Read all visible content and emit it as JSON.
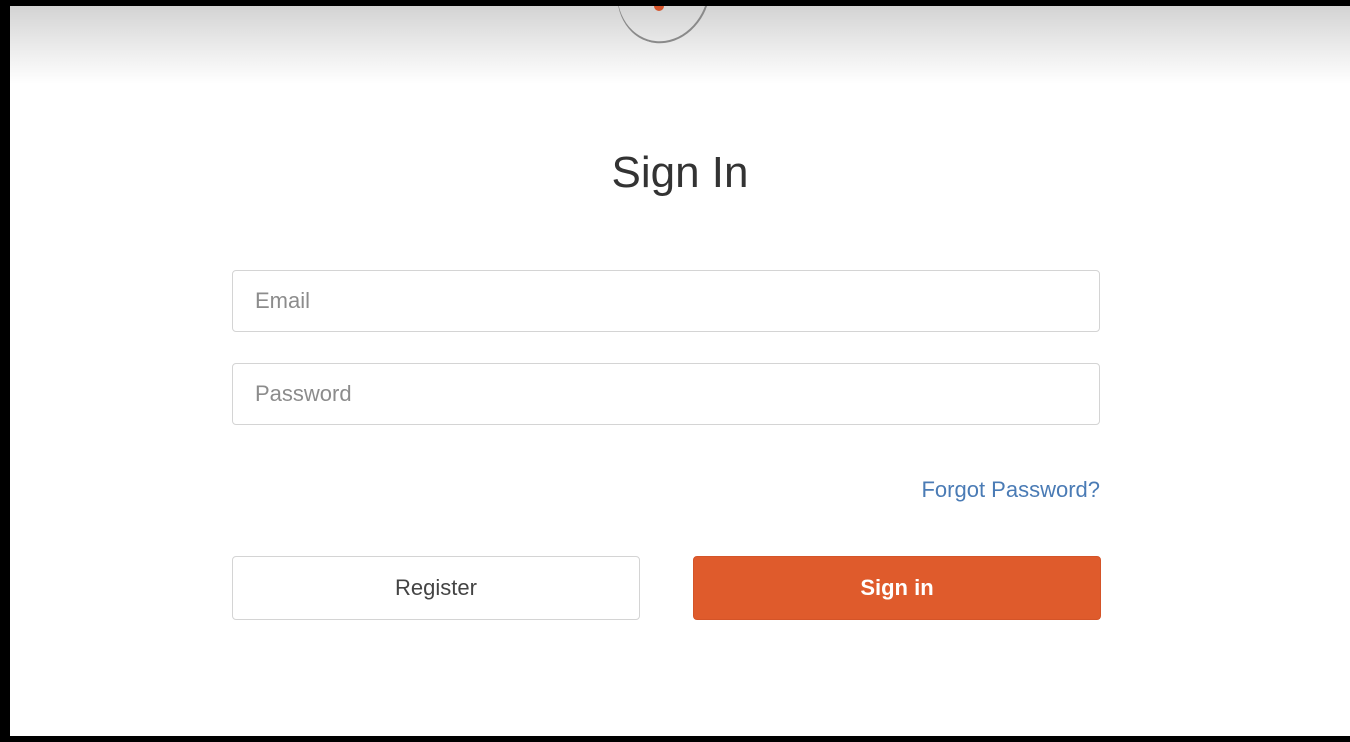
{
  "login": {
    "title": "Sign In",
    "email_placeholder": "Email",
    "password_placeholder": "Password",
    "forgot_label": "Forgot Password?",
    "register_label": "Register",
    "signin_label": "Sign in"
  },
  "colors": {
    "primary": "#df5b2c",
    "link": "#4a7bb5"
  }
}
